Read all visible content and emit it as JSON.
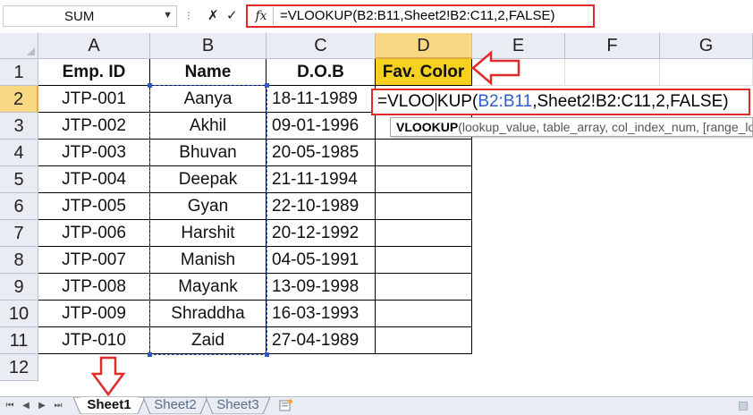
{
  "formula_bar": {
    "name_box_value": "SUM",
    "cancel_symbol": "✗",
    "enter_symbol": "✓",
    "fx_label": "fx",
    "formula": "=VLOOKUP(B2:B11,Sheet2!B2:C11,2,FALSE)"
  },
  "grid": {
    "columns": [
      "A",
      "B",
      "C",
      "D",
      "E",
      "F",
      "G"
    ],
    "rows": [
      "1",
      "2",
      "3",
      "4",
      "5",
      "6",
      "7",
      "8",
      "9",
      "10",
      "11",
      "12"
    ],
    "headers": {
      "emp_id": "Emp. ID",
      "name": "Name",
      "dob": "D.O.B",
      "fav_color": "Fav. Color"
    },
    "records": [
      {
        "emp_id": "JTP-001",
        "name": "Aanya",
        "dob": "18-11-1989"
      },
      {
        "emp_id": "JTP-002",
        "name": "Akhil",
        "dob": "09-01-1996"
      },
      {
        "emp_id": "JTP-003",
        "name": "Bhuvan",
        "dob": "20-05-1985"
      },
      {
        "emp_id": "JTP-004",
        "name": "Deepak",
        "dob": "21-11-1994"
      },
      {
        "emp_id": "JTP-005",
        "name": "Gyan",
        "dob": "22-10-1989"
      },
      {
        "emp_id": "JTP-006",
        "name": "Harshit",
        "dob": "20-12-1992"
      },
      {
        "emp_id": "JTP-007",
        "name": "Manish",
        "dob": "04-05-1991"
      },
      {
        "emp_id": "JTP-008",
        "name": "Mayank",
        "dob": "13-09-1998"
      },
      {
        "emp_id": "JTP-009",
        "name": "Shraddha",
        "dob": "16-03-1993"
      },
      {
        "emp_id": "JTP-010",
        "name": "Zaid",
        "dob": "27-04-1989"
      }
    ],
    "active_cell": "D2",
    "active_edit": {
      "part1": "=VLOO",
      "part2": "KUP(",
      "range_ref": "B2:B11",
      "rest": ",Sheet2!B2:C11,2,FALSE)"
    }
  },
  "tooltip": {
    "function_name": "VLOOKUP",
    "args": "(lookup_value, table_array, col_index_num, [range_lookup])"
  },
  "sheet_tabs": [
    "Sheet1",
    "Sheet2",
    "Sheet3"
  ],
  "active_sheet": "Sheet1",
  "colors": {
    "highlight_header": "#f6d11f",
    "annotation_red": "#e02b2b",
    "selection_blue": "#2f58c7"
  }
}
